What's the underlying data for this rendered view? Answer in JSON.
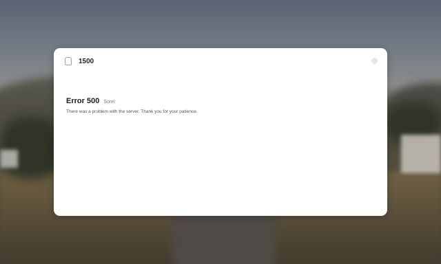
{
  "dialog": {
    "title": "1500",
    "error_title": "Error 500",
    "error_tag": "Sorel",
    "error_message": "There was a problem with the server. Thank you for your patience."
  },
  "icons": {
    "app": "app-badge-icon",
    "close": "close-dot-icon"
  },
  "colors": {
    "panel_background": "#ffffff",
    "title_text": "#1d1d1d",
    "message_text": "#555555"
  }
}
